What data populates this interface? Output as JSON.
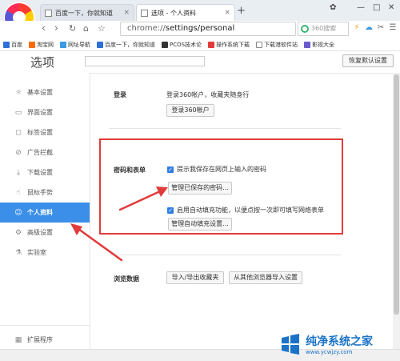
{
  "tabs": [
    {
      "label": "百度一下，你就知道",
      "close": "×"
    },
    {
      "label": "选项 - 个人资料",
      "close": "×"
    }
  ],
  "window": {
    "new_tab": "+",
    "menu": "✿",
    "minimize": "—",
    "maximize": "□",
    "close": "✕"
  },
  "nav": {
    "back": "‹",
    "forward": "›",
    "reload": "↻",
    "home": "⌂",
    "star": "☆",
    "address_prefix": "chrome://",
    "address_main": "settings/personal",
    "search_placeholder": "360搜索",
    "extra_icons": [
      "⚡",
      "☁",
      "✂",
      "☰"
    ]
  },
  "bookmarks": [
    {
      "label": "百度",
      "color": "#2e6fd8"
    },
    {
      "label": "淘宝网",
      "color": "#ff6a00"
    },
    {
      "label": "网址导航",
      "color": "#3b9ae1"
    },
    {
      "label": "百度一下，你就知道",
      "color": "#2e6fd8"
    },
    {
      "label": "PCOS技术论",
      "color": "#333333"
    },
    {
      "label": "操作系统下载",
      "color": "#e23b3b"
    },
    {
      "label": "下载港软件站",
      "color": "#888888"
    },
    {
      "label": "影视大全",
      "color": "#6a5acd"
    }
  ],
  "settings": {
    "title": "选项",
    "search_value": "",
    "reset_label": "恢复默认设置"
  },
  "sidebar": {
    "items": [
      {
        "label": "基本设置",
        "icon": "☼"
      },
      {
        "label": "界面设置",
        "icon": "▭"
      },
      {
        "label": "标签设置",
        "icon": "◻"
      },
      {
        "label": "广告拦截",
        "icon": "⊘"
      },
      {
        "label": "下载设置",
        "icon": "⤓"
      },
      {
        "label": "鼠标手势",
        "icon": "☝"
      },
      {
        "label": "个人资料",
        "icon": "☺"
      },
      {
        "label": "高级设置",
        "icon": "⚙"
      },
      {
        "label": "实验室",
        "icon": "⚗"
      }
    ],
    "active_index": 6,
    "extensions": {
      "label": "扩展程序",
      "icon": "▦"
    }
  },
  "main": {
    "login": {
      "label": "登录",
      "desc": "登录360帐户，收藏夹随身行",
      "button": "登录360帐户"
    },
    "passwords": {
      "label": "密码和表单",
      "save_password_text": "提示我保存在网页上输入的密码",
      "manage_passwords_button": "管理已保存的密码...",
      "autofill_text": "启用自动填充功能，以便点按一次即可填写网络表单",
      "manage_autofill_button": "管理自动填充设置..."
    },
    "browsing_data": {
      "label": "浏览数据",
      "import_export_button": "导入/导出收藏夹",
      "import_other_button": "从其他浏览器导入设置"
    }
  },
  "watermark": {
    "title": "纯净系统之家",
    "url": "www.ycwjzy.com"
  },
  "colors": {
    "accent": "#3c8fe8",
    "highlight_red": "#e23b3b"
  }
}
